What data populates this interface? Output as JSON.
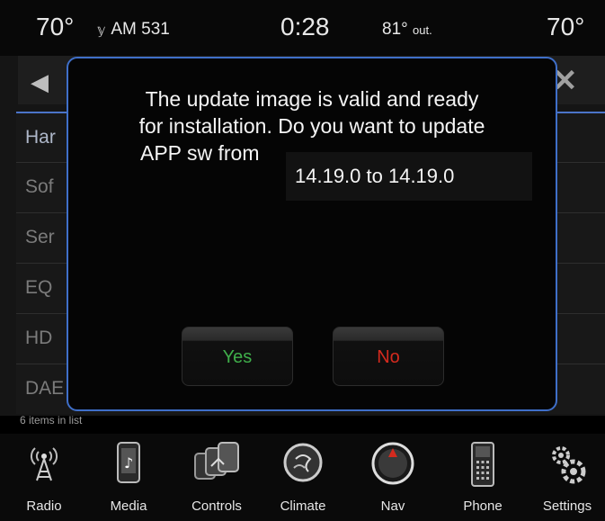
{
  "status_bar": {
    "temp_left": "70°",
    "radio": "AM 531",
    "clock": "0:28",
    "outside_temp": "81°",
    "outside_label": "out.",
    "temp_right": "70°"
  },
  "settings_list": {
    "items": [
      "Har",
      "Sof",
      "Ser",
      "EQ",
      "HD",
      "DAE"
    ],
    "count_text": "6 items in list"
  },
  "dialog": {
    "line1": "The update image is valid and ready",
    "line2": "for installation. Do you want to update",
    "line3": "APP sw from",
    "version_text": "14.19.0 to 14.19.0",
    "yes_label": "Yes",
    "no_label": "No",
    "yes_color": "#3fae4a",
    "no_color": "#d42a1e",
    "border_color": "#3f6fc9"
  },
  "nav": {
    "items": [
      {
        "label": "Radio",
        "icon": "radio-tower-icon"
      },
      {
        "label": "Media",
        "icon": "media-icon"
      },
      {
        "label": "Controls",
        "icon": "controls-icon"
      },
      {
        "label": "Climate",
        "icon": "climate-icon"
      },
      {
        "label": "Nav",
        "icon": "nav-compass-icon"
      },
      {
        "label": "Phone",
        "icon": "phone-icon"
      },
      {
        "label": "Settings",
        "icon": "gears-icon"
      }
    ]
  }
}
